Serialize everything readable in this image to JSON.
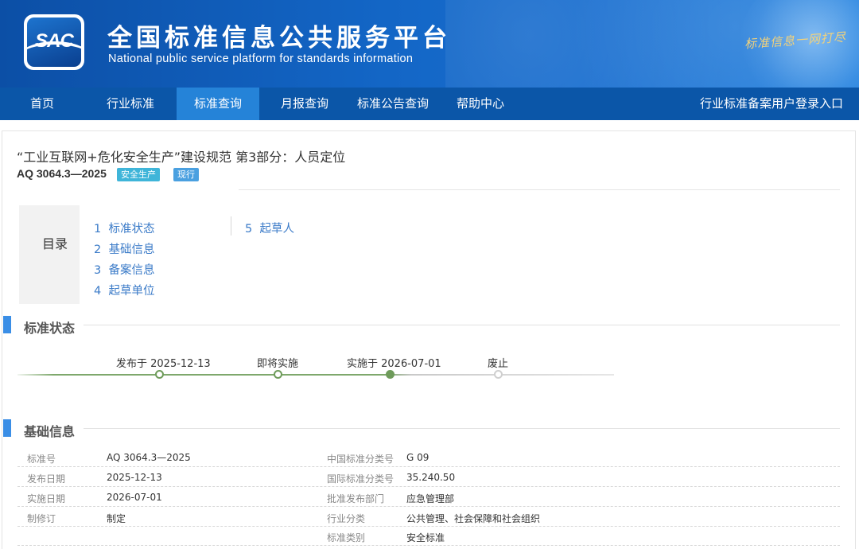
{
  "header": {
    "logo_text": "SAC",
    "title": "全国标准信息公共服务平台",
    "subtitle": "National public service platform  for standards information",
    "slogan": "标准信息一网打尽"
  },
  "nav": {
    "items": [
      {
        "label": "首页"
      },
      {
        "label": "行业标准"
      },
      {
        "label": "标准查询",
        "active": true
      },
      {
        "label": "月报查询"
      },
      {
        "label": "标准公告查询"
      },
      {
        "label": "帮助中心"
      }
    ],
    "login_link": "行业标准备案用户登录入口"
  },
  "standard": {
    "title": "“工业互联网+危化安全生产”建设规范 第3部分：人员定位",
    "code": "AQ 3064.3—2025",
    "category_badge": "安全生产",
    "status_badge": "现行"
  },
  "toc": {
    "label": "目录",
    "items": [
      {
        "num": "1",
        "label": "标准状态"
      },
      {
        "num": "2",
        "label": "基础信息"
      },
      {
        "num": "3",
        "label": "备案信息"
      },
      {
        "num": "4",
        "label": "起草单位"
      },
      {
        "num": "5",
        "label": "起草人"
      }
    ]
  },
  "status_section": {
    "title": "标准状态",
    "timeline": [
      {
        "label": "发布于 2025-12-13",
        "state": "done"
      },
      {
        "label": "即将实施",
        "state": "done"
      },
      {
        "label": "实施于 2026-07-01",
        "state": "current"
      },
      {
        "label": "废止",
        "state": "pending"
      }
    ]
  },
  "basic_section": {
    "title": "基础信息",
    "rows": [
      {
        "k1": "标准号",
        "v1": "AQ 3064.3—2025",
        "k2": "中国标准分类号",
        "v2": "G 09"
      },
      {
        "k1": "发布日期",
        "v1": "2025-12-13",
        "k2": "国际标准分类号",
        "v2": "35.240.50"
      },
      {
        "k1": "实施日期",
        "v1": "2026-07-01",
        "k2": "批准发布部门",
        "v2": "应急管理部"
      },
      {
        "k1": "制修订",
        "v1": "制定",
        "k2": "行业分类",
        "v2": "公共管理、社会保障和社会组织"
      },
      {
        "k1": "",
        "v1": "",
        "k2": "标准类别",
        "v2": "安全标准"
      }
    ]
  },
  "colors": {
    "nav_bg": "#0b56a8",
    "nav_active": "#2583d8",
    "link": "#3b7bc8",
    "section_accent": "#3a8ee6",
    "timeline_green": "#6e9b5a"
  }
}
